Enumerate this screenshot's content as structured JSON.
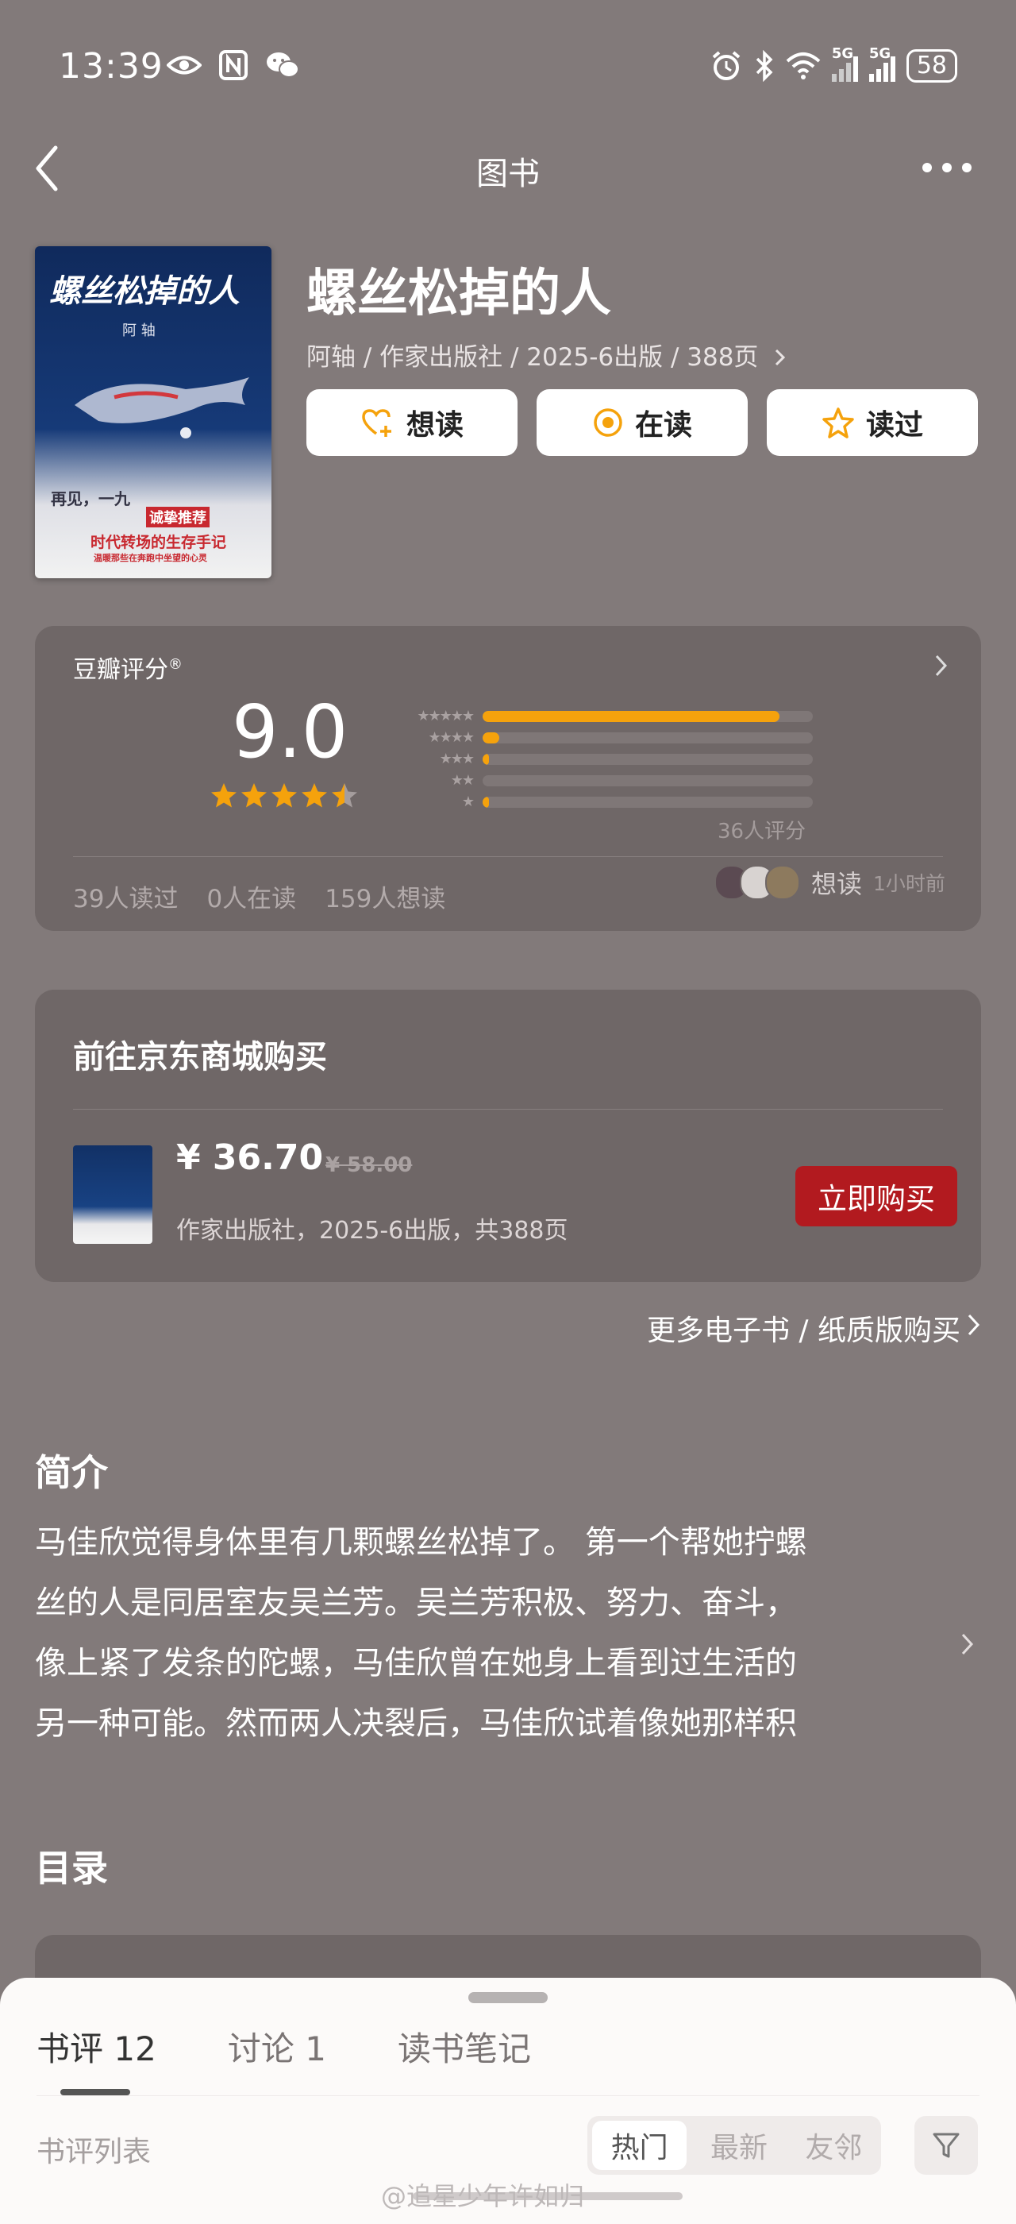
{
  "status_bar": {
    "time": "13:39",
    "battery": "58",
    "net1": "5G",
    "net2": "5G"
  },
  "nav": {
    "title": "图书"
  },
  "book": {
    "title": "螺丝松掉的人",
    "meta": "阿轴 / 作家出版社 / 2025-6出版 / 388页",
    "cover": {
      "title": "螺丝松掉的人",
      "author": "阿 轴",
      "tagline": "再见，一九",
      "promo": "诚挚推荐",
      "slogan": "时代转场的生存手记",
      "slogan2": "温暖那些在奔跑中坐望的心灵"
    },
    "actions": [
      {
        "label": "想读",
        "icon": "heart-plus-icon"
      },
      {
        "label": "在读",
        "icon": "reading-circle-icon"
      },
      {
        "label": "读过",
        "icon": "star-outline-icon"
      }
    ]
  },
  "rating": {
    "label": "豆瓣评分",
    "mark": "®",
    "score": "9.0",
    "stars": 4.5,
    "distribution": [
      0.9,
      0.05,
      0.02,
      0,
      0.02
    ],
    "star_labels": [
      "★★★★★",
      "★★★★",
      "★★★",
      "★★",
      "★"
    ],
    "count": "36人评分",
    "stats": [
      "39人读过",
      "0人在读",
      "159人想读"
    ],
    "want_label": "想读",
    "want_time": "1小时前"
  },
  "purchase": {
    "title": "前往京东商城购买",
    "price": "¥ 36.70",
    "old_price": "¥ 58.00",
    "meta": "作家出版社，2025-6出版，共388页",
    "button": "立即购买",
    "more": "更多电子书 / 纸质版购买"
  },
  "intro": {
    "title": "简介",
    "lines": [
      "马佳欣觉得身体里有几颗螺丝松掉了。 第一个帮她拧螺",
      "丝的人是同居室友吴兰芳。吴兰芳积极、努力、奋斗，",
      "像上紧了发条的陀螺，马佳欣曾在她身上看到过生活的",
      "另一种可能。然而两人决裂后，马佳欣试着像她那样积"
    ]
  },
  "toc": {
    "title": "目录"
  },
  "sheet": {
    "tabs": [
      {
        "label": "书评",
        "count": "12"
      },
      {
        "label": "讨论",
        "count": "1"
      },
      {
        "label": "读书笔记",
        "count": ""
      }
    ],
    "list_label": "书评列表",
    "segments": [
      "热门",
      "最新",
      "友邻"
    ]
  },
  "watermark": "@追星少年许如归",
  "colors": {
    "accent": "#f5a20c",
    "buy_red": "#b21a1f",
    "bg": "#827a7a",
    "card": "#6f6767"
  }
}
